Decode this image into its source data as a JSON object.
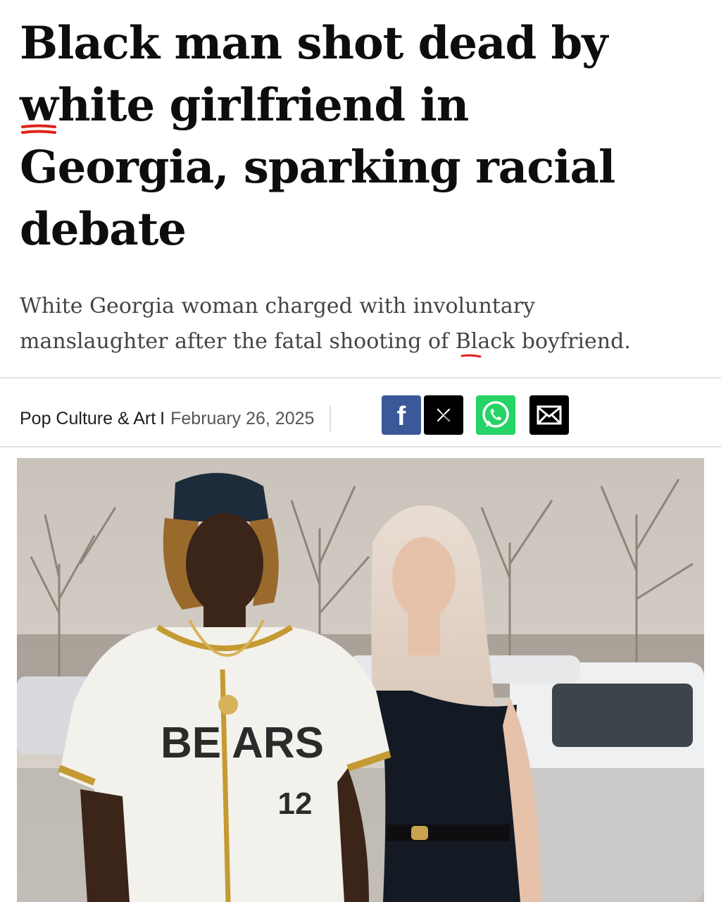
{
  "article": {
    "headline_lines": [
      "Black man shot dead by",
      "white girlfriend in",
      "Georgia, sparking racial",
      "debate"
    ],
    "subheadline_lines": [
      "White Georgia woman charged with involuntary",
      "manslaughter after the fatal shooting of Black boyfriend."
    ],
    "category": "Pop Culture & Art",
    "separator": "I",
    "date": "February 26, 2025"
  },
  "share": [
    {
      "icon": "facebook-icon",
      "glyph": "f",
      "color": "#3b5998"
    },
    {
      "icon": "x-icon",
      "glyph": "𝕏",
      "color": "#000000"
    },
    {
      "icon": "whatsapp-icon",
      "color": "#25d366"
    },
    {
      "icon": "mail-icon",
      "color": "#000000"
    }
  ],
  "photo": {
    "jersey_text": "BE ARS",
    "jersey_number": "12"
  },
  "colors": {
    "annotation_red": "#e0241b"
  }
}
